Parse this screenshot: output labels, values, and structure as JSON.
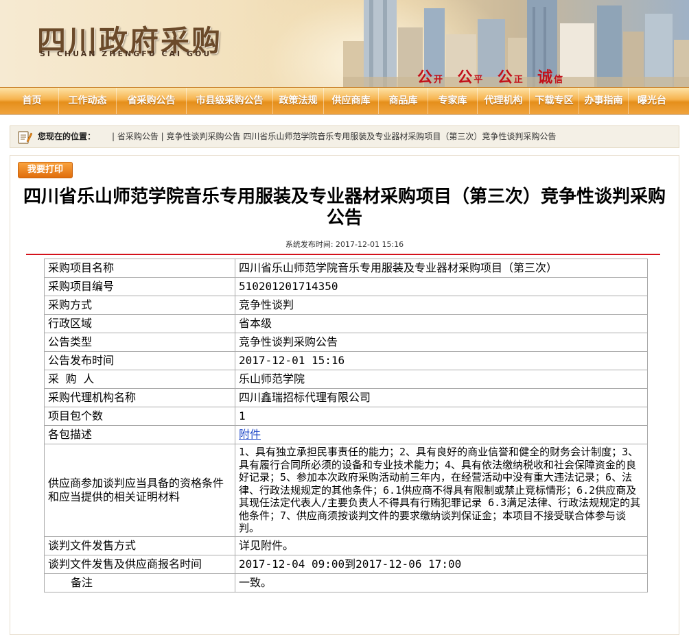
{
  "banner": {
    "logo_cn": "四川政府采购",
    "logo_en": "SI CHUAN ZHENGFU CAI GOU",
    "motto": [
      {
        "big": "公",
        "small": "开"
      },
      {
        "big": "公",
        "small": "平"
      },
      {
        "big": "公",
        "small": "正"
      },
      {
        "big": "诚",
        "small": "信"
      }
    ]
  },
  "nav": {
    "items": [
      "首页",
      "工作动态",
      "省采购公告",
      "市县级采购公告",
      "政策法规",
      "供应商库",
      "商品库",
      "专家库",
      "代理机构",
      "下载专区",
      "办事指南",
      "曝光台"
    ]
  },
  "breadcrumb": {
    "label": "您现在的位置：",
    "path": "| 省采购公告 | 竞争性谈判采购公告 四川省乐山师范学院音乐专用服装及专业器材采购项目（第三次）竞争性谈判采购公告"
  },
  "print_button": "我要打印",
  "article": {
    "title": "四川省乐山师范学院音乐专用服装及专业器材采购项目（第三次）竞争性谈判采购公告",
    "publish_time": "系统发布时间: 2017-12-01 15:16"
  },
  "info_table": [
    {
      "key": "采购项目名称",
      "value": "四川省乐山师范学院音乐专用服装及专业器材采购项目（第三次）"
    },
    {
      "key": "采购项目编号",
      "value": "510201201714350"
    },
    {
      "key": "采购方式",
      "value": "竞争性谈判"
    },
    {
      "key": "行政区域",
      "value": "省本级"
    },
    {
      "key": "公告类型",
      "value": "竞争性谈判采购公告"
    },
    {
      "key": "公告发布时间",
      "value": "2017-12-01 15:16"
    },
    {
      "key": "采 购 人",
      "value": "乐山师范学院"
    },
    {
      "key": "采购代理机构名称",
      "value": "四川鑫瑞招标代理有限公司"
    },
    {
      "key": "项目包个数",
      "value": "1"
    },
    {
      "key": "各包描述",
      "value": "附件"
    },
    {
      "key": "供应商参加谈判应当具备的资格条件和应当提供的相关证明材料",
      "value": "1、具有独立承担民事责任的能力；2、具有良好的商业信誉和健全的财务会计制度；3、具有履行合同所必须的设备和专业技术能力；4、具有依法缴纳税收和社会保障资金的良好记录；5、参加本次政府采购活动前三年内，在经营活动中没有重大违法记录；6、法律、行政法规规定的其他条件；6.1供应商不得具有限制或禁止竞标情形；6.2供应商及其现任法定代表人/主要负责人不得具有行贿犯罪记录 6.3满足法律、行政法规规定的其他条件；7、供应商须按谈判文件的要求缴纳谈判保证金；本项目不接受联合体参与谈判。"
    },
    {
      "key": "谈判文件发售方式",
      "value": "详见附件。"
    },
    {
      "key": "谈判文件发售及供应商报名时间",
      "value": "2017-12-04 09:00到2017-12-06 17:00"
    },
    {
      "key": "备注",
      "value": "一致。"
    }
  ]
}
